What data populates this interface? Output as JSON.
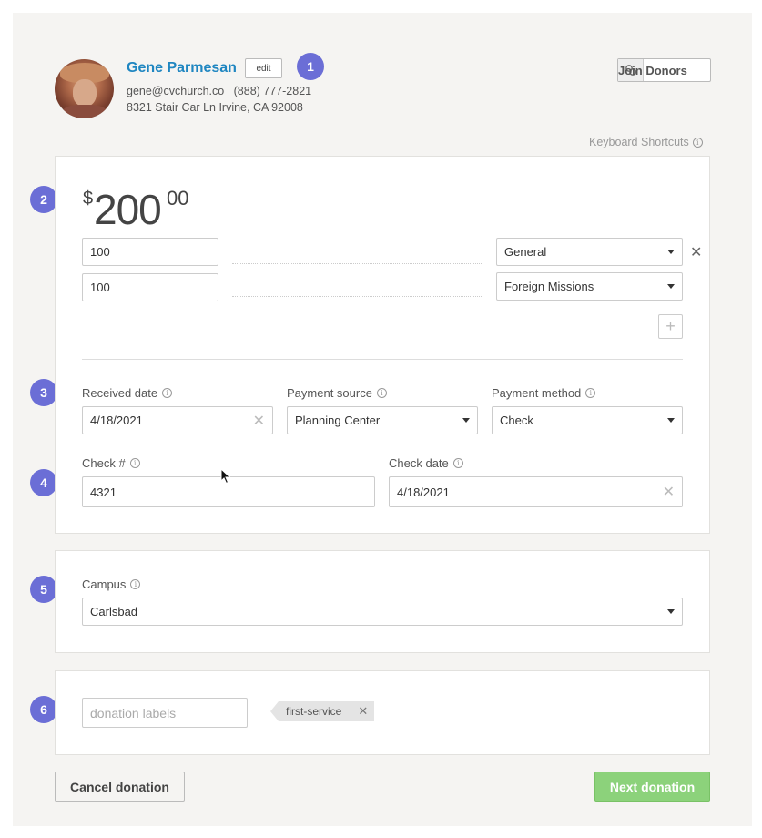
{
  "donor": {
    "name": "Gene Parmesan",
    "edit_label": "edit",
    "email": "gene@cvchurch.co",
    "phone": "(888) 777-2821",
    "address": "8321 Stair Car Ln Irvine, CA 92008"
  },
  "join_donors_label": "Join Donors",
  "keyboard_shortcuts_label": "Keyboard Shortcuts",
  "steps": [
    "1",
    "2",
    "3",
    "4",
    "5",
    "6"
  ],
  "amount": {
    "currency": "$",
    "whole": "200",
    "cents": "00"
  },
  "splits": [
    {
      "amount": "100",
      "fund": "General"
    },
    {
      "amount": "100",
      "fund": "Foreign Missions"
    }
  ],
  "received_date": {
    "label": "Received date",
    "value": "4/18/2021"
  },
  "payment_source": {
    "label": "Payment source",
    "value": "Planning Center"
  },
  "payment_method": {
    "label": "Payment method",
    "value": "Check"
  },
  "check_number": {
    "label": "Check #",
    "value": "4321"
  },
  "check_date": {
    "label": "Check date",
    "value": "4/18/2021"
  },
  "campus": {
    "label": "Campus",
    "value": "Carlsbad"
  },
  "labels": {
    "placeholder": "donation labels",
    "tags": [
      "first-service"
    ]
  },
  "actions": {
    "cancel": "Cancel donation",
    "next": "Next donation"
  },
  "colors": {
    "accent": "#6b6ed6",
    "link": "#1f86c1",
    "primary_button": "#8cd27b"
  }
}
